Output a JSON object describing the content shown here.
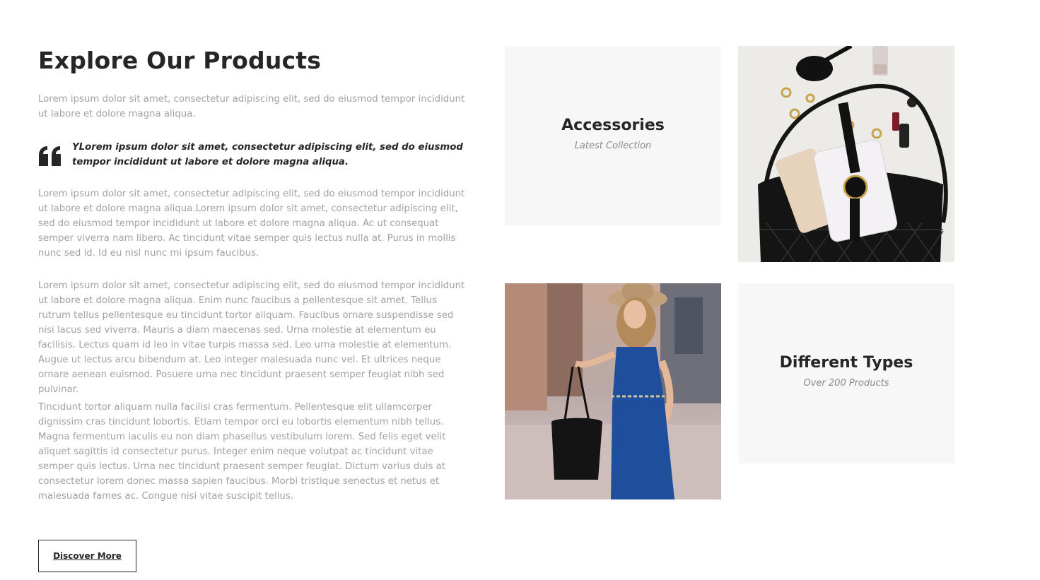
{
  "section": {
    "title": "Explore Our Products",
    "intro": "Lorem ipsum dolor sit amet, consectetur adipiscing elit, sed do eiusmod tempor incididunt ut labore et dolore magna aliqua.",
    "quote": "YLorem ipsum dolor sit amet, consectetur adipiscing elit, sed do eiusmod tempor incididunt ut labore et dolore magna aliqua.",
    "paragraph2": "Lorem ipsum dolor sit amet, consectetur adipiscing elit, sed do eiusmod tempor incididunt ut labore et dolore magna aliqua.Lorem ipsum dolor sit amet, consectetur adipiscing elit, sed do eiusmod tempor incididunt ut labore et dolore magna aliqua. Ac ut consequat semper viverra nam libero. Ac tincidunt vitae semper quis lectus nulla at. Purus in mollis nunc sed id. Id eu nisl nunc mi ipsum faucibus.",
    "paragraph3": "Lorem ipsum dolor sit amet, consectetur adipiscing elit, sed do eiusmod tempor incididunt ut labore et dolore magna aliqua. Enim nunc faucibus a pellentesque sit amet. Tellus rutrum tellus pellentesque eu tincidunt tortor aliquam. Faucibus ornare suspendisse sed nisi lacus sed viverra. Mauris a diam maecenas sed. Urna molestie at elementum eu facilisis. Lectus quam id leo in vitae turpis massa sed. Leo urna molestie at elementum. Augue ut lectus arcu bibendum at. Leo integer malesuada nunc vel. Et ultrices neque ornare aenean euismod. Posuere urna nec tincidunt praesent semper feugiat nibh sed pulvinar.",
    "paragraph4": "Tincidunt tortor aliquam nulla facilisi cras fermentum. Pellentesque elit ullamcorper dignissim cras tincidunt lobortis. Etiam tempor orci eu lobortis elementum nibh tellus. Magna fermentum iaculis eu non diam phasellus vestibulum lorem. Sed felis eget velit aliquet sagittis id consectetur purus. Integer enim neque volutpat ac tincidunt vitae semper quis lectus. Urna nec tincidunt praesent semper feugiat. Dictum varius duis at consectetur lorem donec massa sapien faucibus. Morbi tristique senectus et netus et malesuada fames ac. Congue nisi vitae suscipit tellus.",
    "button_label": "Discover More",
    "quote_icon": "quote-icon"
  },
  "cards": {
    "accessories": {
      "title": "Accessories",
      "subtitle": "Latest Collection"
    },
    "types": {
      "title": "Different Types",
      "subtitle": "Over 200 Products"
    }
  },
  "colors": {
    "heading": "#262626",
    "body_text": "#a2a2a2",
    "card_bg": "#f7f7f7"
  }
}
